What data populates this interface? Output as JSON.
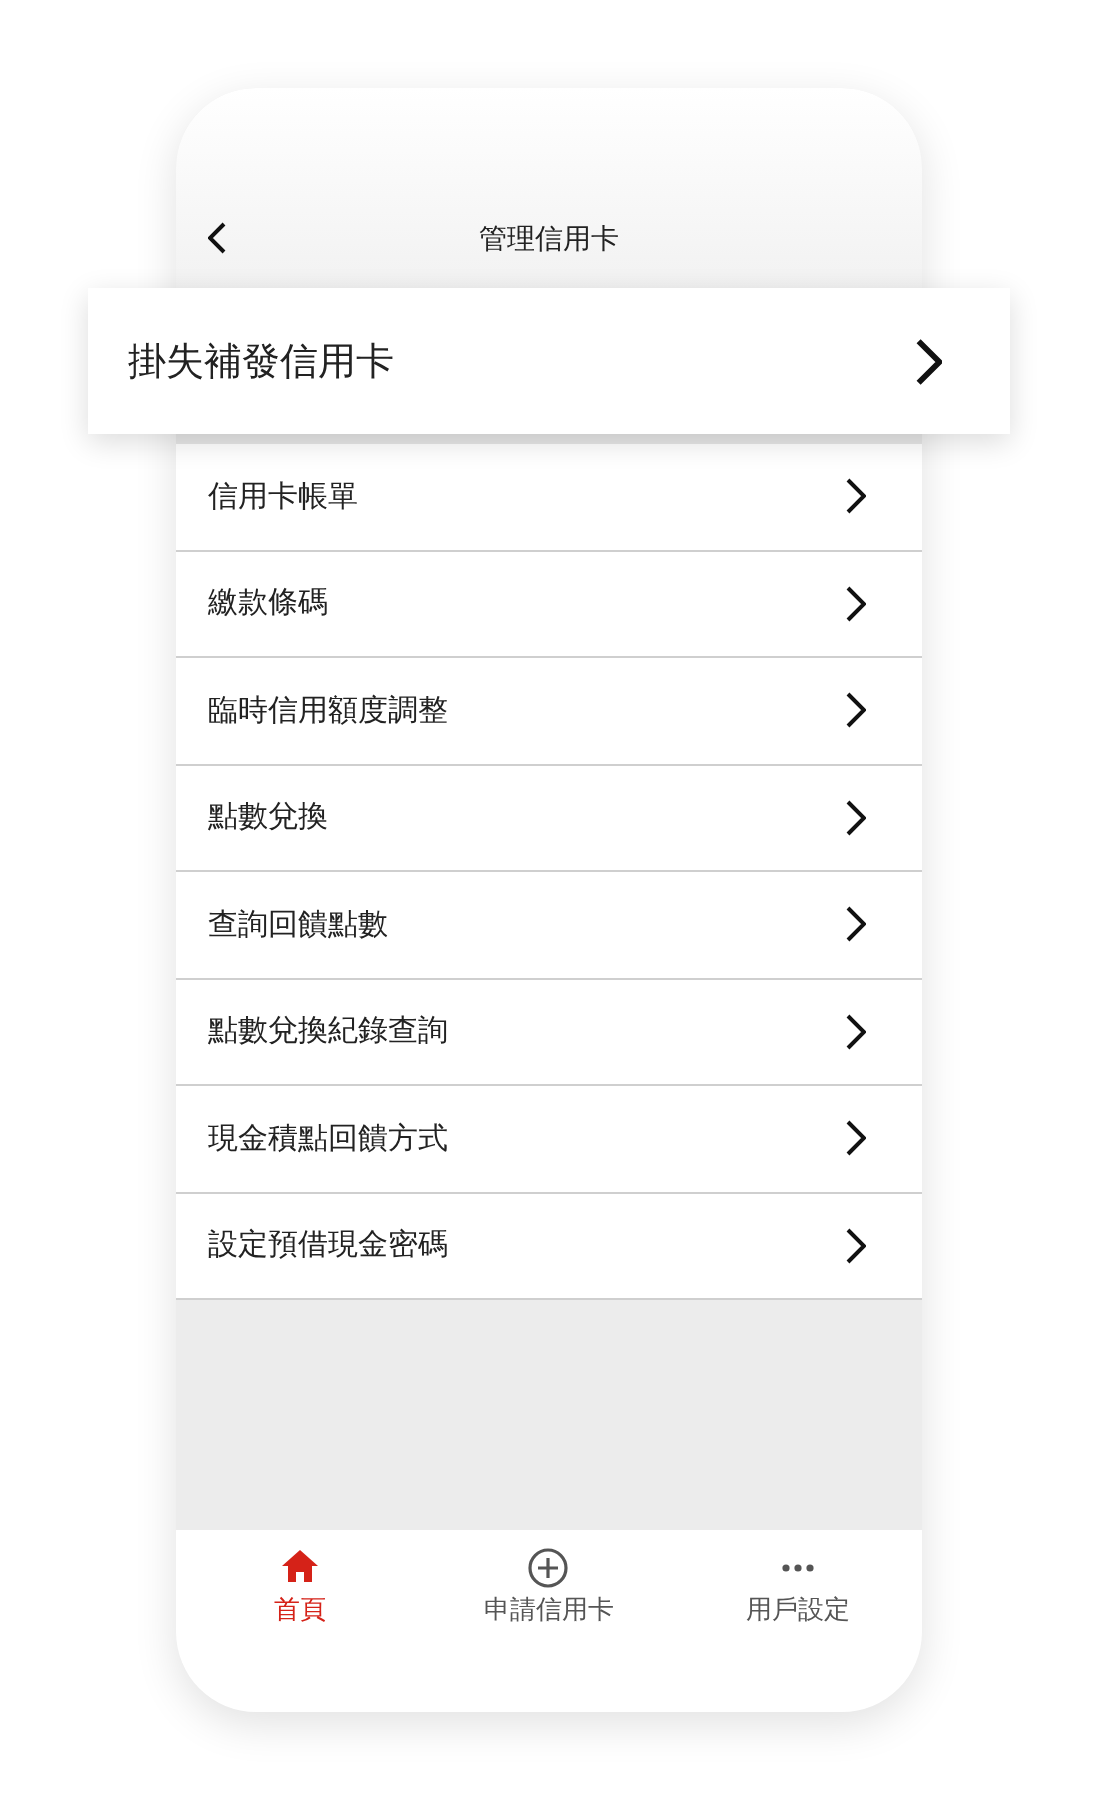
{
  "header": {
    "title": "管理信用卡"
  },
  "highlighted_item": {
    "label": "掛失補發信用卡"
  },
  "menu_items": [
    {
      "label": "信用卡帳單"
    },
    {
      "label": "繳款條碼"
    },
    {
      "label": "臨時信用額度調整"
    },
    {
      "label": "點數兌換"
    },
    {
      "label": "查詢回饋點數"
    },
    {
      "label": "點數兌換紀錄查詢"
    },
    {
      "label": "現金積點回饋方式"
    },
    {
      "label": "設定預借現金密碼"
    }
  ],
  "tabs": [
    {
      "label": "首頁",
      "kind": "home",
      "selected": true
    },
    {
      "label": "申請信用卡",
      "kind": "add",
      "selected": false
    },
    {
      "label": "用戶設定",
      "kind": "more",
      "selected": false
    }
  ]
}
